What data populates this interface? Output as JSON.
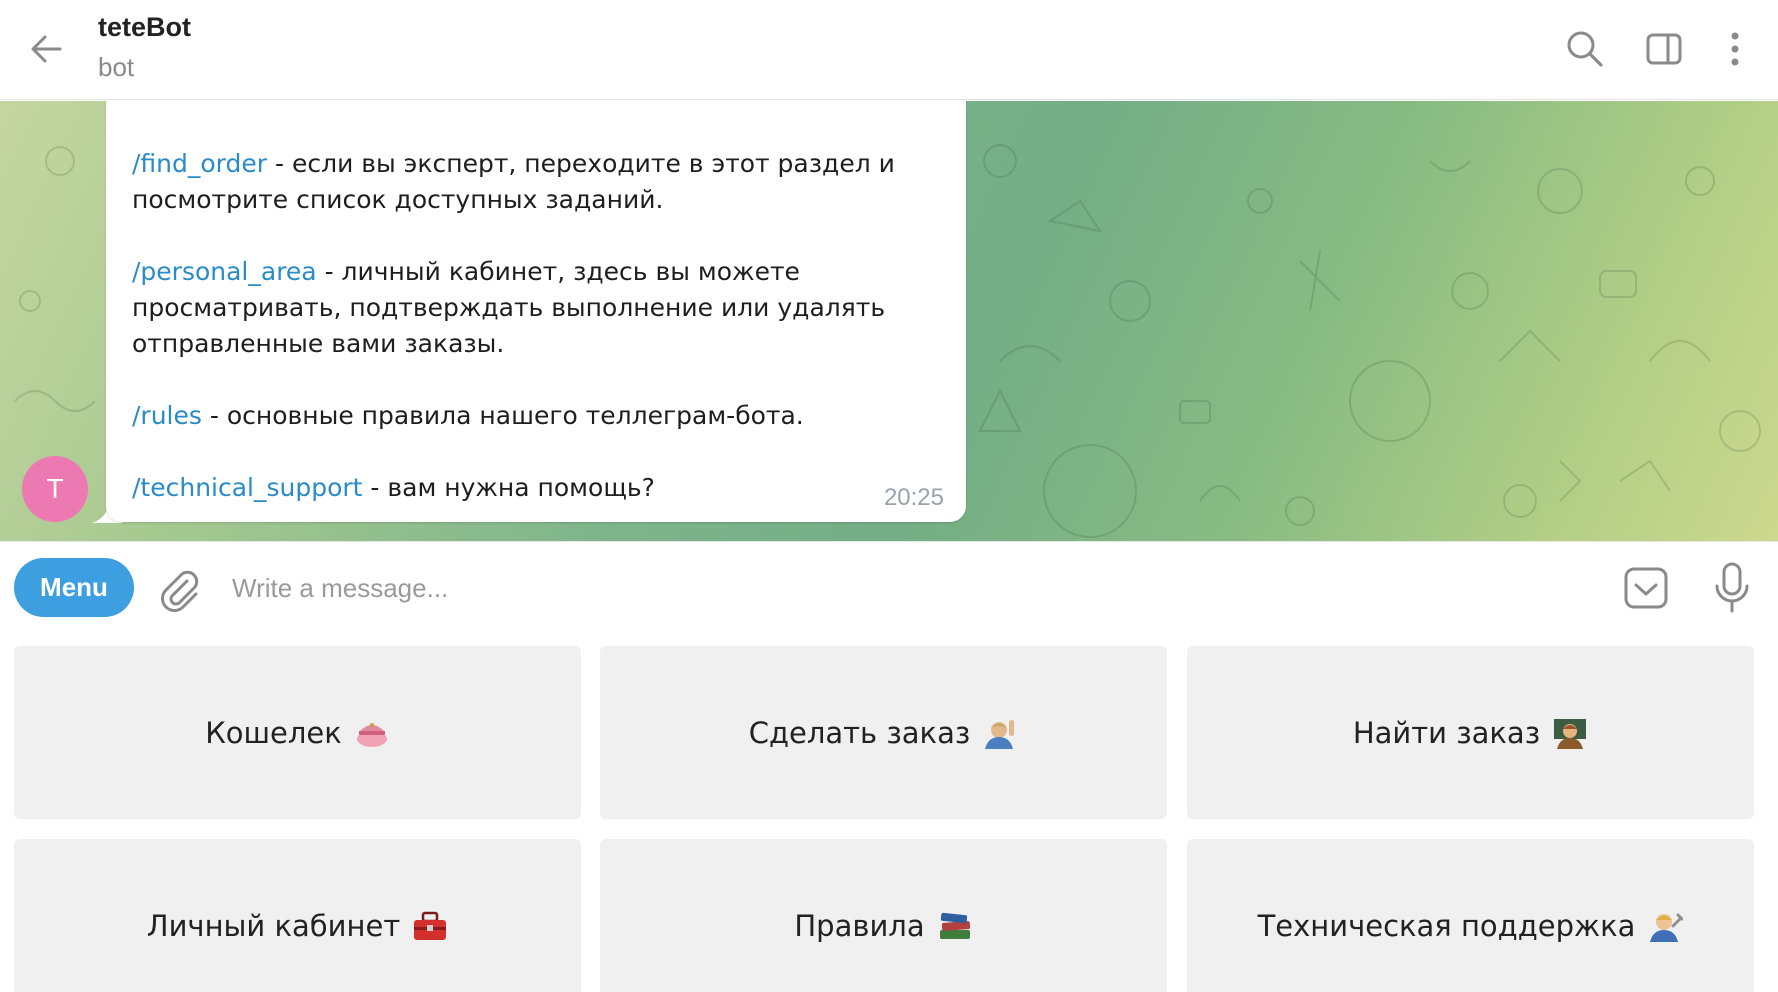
{
  "header": {
    "title": "teteBot",
    "subtitle": "bot"
  },
  "message": {
    "lines": [
      {
        "cmd": "/find_order",
        "text": " - если вы эксперт, переходите в этот раздел и посмотрите список доступных заданий."
      },
      {
        "cmd": "/personal_area",
        "text": " - личный кабинет, здесь вы можете просматривать, подтверждать выполнение или удалять отправленные вами заказы."
      },
      {
        "cmd": "/rules",
        "text": " - основные правила нашего теллеграм-бота."
      },
      {
        "cmd": "/technical_support",
        "text": " - вам нужна помощь?"
      }
    ],
    "time": "20:25",
    "avatar_letter": "T"
  },
  "input": {
    "menu_label": "Menu",
    "placeholder": "Write a message..."
  },
  "keyboard": {
    "buttons": [
      {
        "label": "Кошелек",
        "icon": "purse-emoji"
      },
      {
        "label": "Сделать заказ",
        "icon": "person-raising-hand-emoji"
      },
      {
        "label": "Найти заказ",
        "icon": "teacher-emoji"
      },
      {
        "label": "Личный кабинет",
        "icon": "toolbox-emoji"
      },
      {
        "label": "Правила",
        "icon": "books-emoji"
      },
      {
        "label": "Техническая поддержка",
        "icon": "mechanic-emoji"
      }
    ]
  },
  "colors": {
    "accent": "#3d9fe0",
    "command_link": "#2a8bc9",
    "avatar": "#ec79b2"
  }
}
